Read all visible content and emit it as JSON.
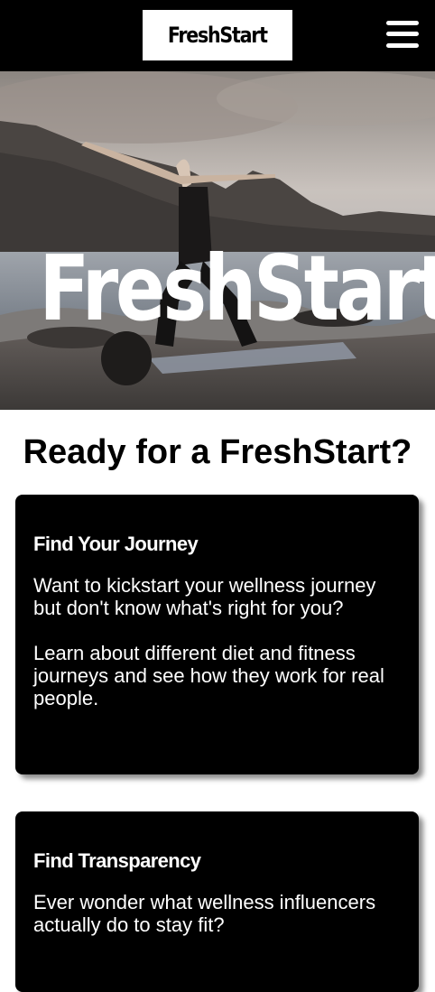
{
  "header": {
    "logo_text": "FreshStart",
    "menu_icon": "hamburger-menu-icon"
  },
  "hero": {
    "title": "FreshStart",
    "image_description_icon": "yoga-on-beach-photo"
  },
  "main": {
    "heading": "Ready for a FreshStart?",
    "cards": [
      {
        "title": "Find Your Journey",
        "paragraphs": [
          "Want to kickstart your wellness journey but don't know what's right for you?",
          "Learn about different diet and fitness journeys and see how they work for real people."
        ]
      },
      {
        "title": "Find Transparency",
        "paragraphs": [
          "Ever wonder what wellness influencers actually do to stay fit?"
        ]
      }
    ]
  },
  "colors": {
    "header_bg": "#000000",
    "card_bg": "#000000",
    "page_bg": "#ffffff",
    "text_light": "#ffffff"
  }
}
